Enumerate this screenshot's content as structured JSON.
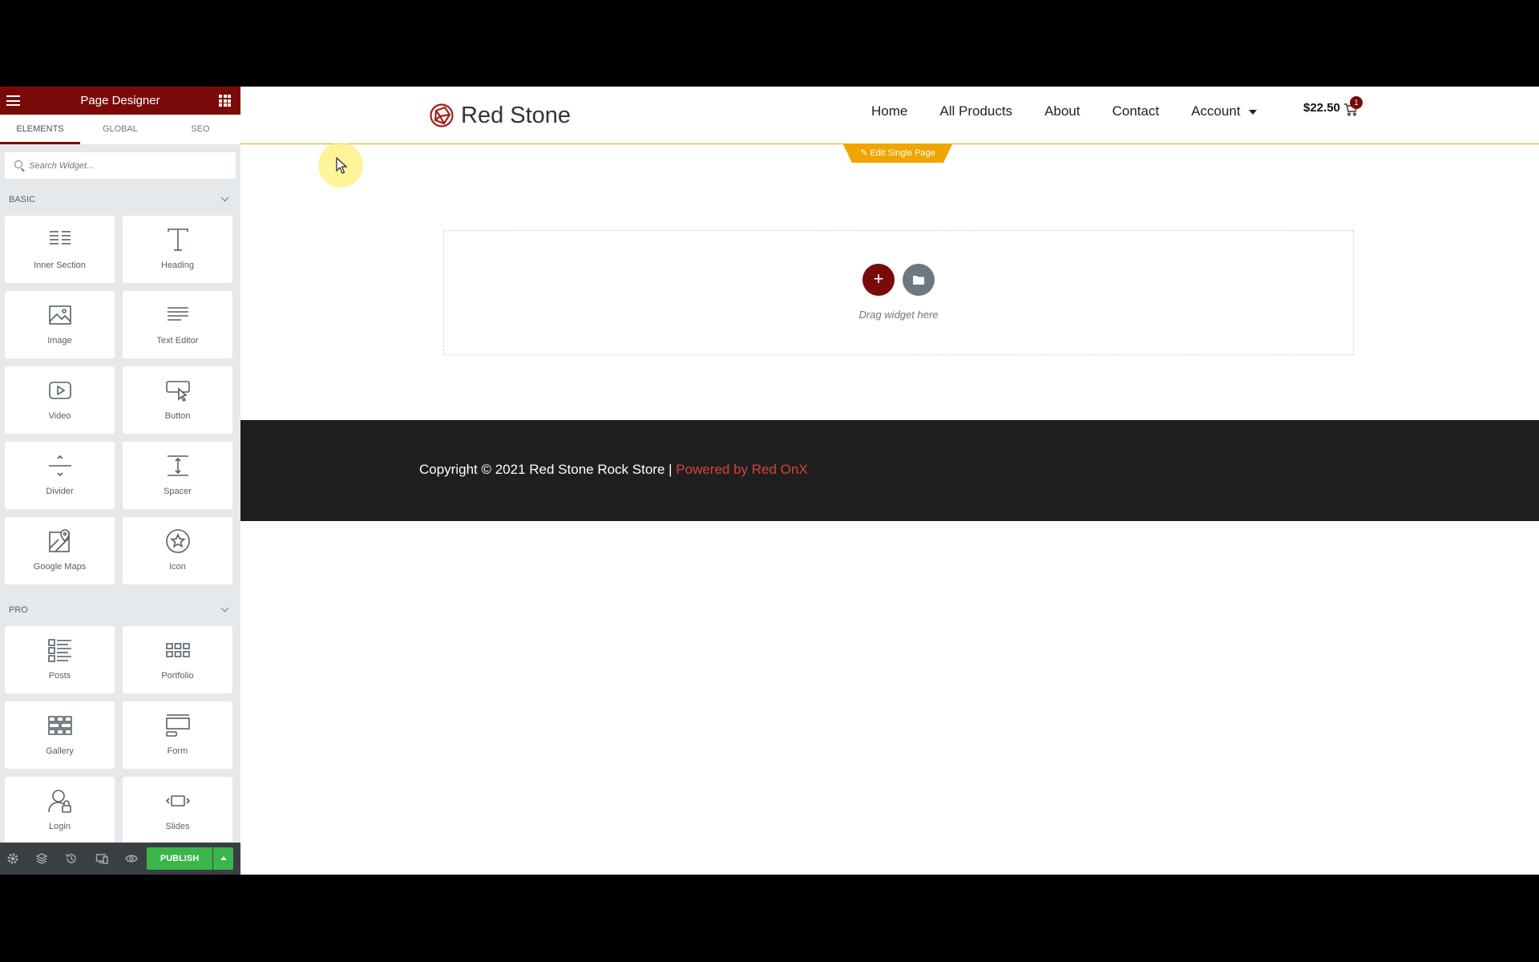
{
  "panel": {
    "title": "Page Designer",
    "tabs": [
      {
        "label": "ELEMENTS",
        "active": true
      },
      {
        "label": "GLOBAL",
        "active": false
      },
      {
        "label": "SEO",
        "active": false
      }
    ],
    "search_placeholder": "Search Widget...",
    "basic_label": "BASIC",
    "pro_label": "PRO",
    "basic_widgets": [
      {
        "label": "Inner Section",
        "icon": "inner-section-icon"
      },
      {
        "label": "Heading",
        "icon": "heading-icon"
      },
      {
        "label": "Image",
        "icon": "image-icon"
      },
      {
        "label": "Text Editor",
        "icon": "text-editor-icon"
      },
      {
        "label": "Video",
        "icon": "video-icon"
      },
      {
        "label": "Button",
        "icon": "button-icon"
      },
      {
        "label": "Divider",
        "icon": "divider-icon"
      },
      {
        "label": "Spacer",
        "icon": "spacer-icon"
      },
      {
        "label": "Google Maps",
        "icon": "google-maps-icon"
      },
      {
        "label": "Icon",
        "icon": "star-icon"
      }
    ],
    "pro_widgets": [
      {
        "label": "Posts",
        "icon": "posts-icon"
      },
      {
        "label": "Portfolio",
        "icon": "portfolio-icon"
      },
      {
        "label": "Gallery",
        "icon": "gallery-icon"
      },
      {
        "label": "Form",
        "icon": "form-icon"
      },
      {
        "label": "Login",
        "icon": "login-icon"
      },
      {
        "label": "Slides",
        "icon": "slides-icon"
      }
    ],
    "publish_label": "PUBLISH"
  },
  "site": {
    "brand": "Red Stone",
    "nav": [
      "Home",
      "All Products",
      "About",
      "Contact",
      "Account"
    ],
    "cart_total": "$22.50",
    "cart_count": "1",
    "edit_tab": "Edit Single Page",
    "dropzone_text": "Drag widget here",
    "footer_copy": "Copyright © 2021 Red Stone Rock Store | ",
    "footer_powered": "Powered by Red OnX"
  },
  "colors": {
    "brand": "#7a0a0a",
    "accent": "#f0a500",
    "publish": "#39b54a",
    "footer_bg": "#1f1f1f",
    "powered": "#d9413b"
  }
}
